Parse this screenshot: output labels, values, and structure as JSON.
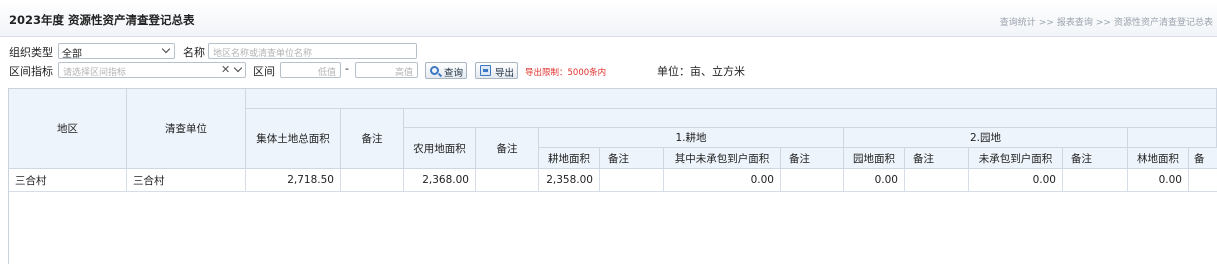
{
  "header": {
    "title": "2023年度 资源性资产清查登记总表",
    "breadcrumb": [
      "查询统计",
      "报表查询",
      "资源性资产清查登记总表"
    ],
    "breadcrumb_sep": ">>"
  },
  "filters": {
    "org_type_label": "组织类型",
    "org_type_value": "全部",
    "name_label": "名称",
    "name_placeholder": "地区名称或清查单位名称",
    "range_indicator_label": "区间指标",
    "range_indicator_placeholder": "请选择区间指标",
    "range_label": "区间",
    "low_placeholder": "低值",
    "range_dash": "-",
    "high_placeholder": "高值",
    "search_button": "查询",
    "export_button": "导出",
    "export_limit": "导出限制：5000条内",
    "unit_text": "单位：亩、立方米"
  },
  "table": {
    "col_region": "地区",
    "col_unit": "清查单位",
    "col_collective_total": "集体土地总面积",
    "col_note": "备注",
    "col_agri_area": "农用地面积",
    "group_farmland": "1.耕地",
    "group_garden": "2.园地",
    "col_farmland_area": "耕地面积",
    "col_farmland_uncontracted": "其中未承包到户面积",
    "col_garden_area": "园地面积",
    "col_garden_uncontracted": "未承包到户面积",
    "col_forest_area": "林地面积",
    "col_forest_note_partial": "备",
    "rows": [
      {
        "region": "三合村",
        "unit": "三合村",
        "collective_total": "2,718.50",
        "collective_note": "",
        "agri_area": "2,368.00",
        "agri_note": "",
        "farmland_area": "2,358.00",
        "farmland_note": "",
        "farmland_uncontracted": "0.00",
        "farmland_uncontracted_note": "",
        "garden_area": "0.00",
        "garden_note": "",
        "garden_uncontracted": "0.00",
        "garden_uncontracted_note": "",
        "forest_area": "0.00"
      }
    ]
  },
  "colors": {
    "header_bg": "#eef4fb",
    "border": "#cfd8e2",
    "limit_text": "#e0302b",
    "accent_blue": "#3d78c4"
  }
}
